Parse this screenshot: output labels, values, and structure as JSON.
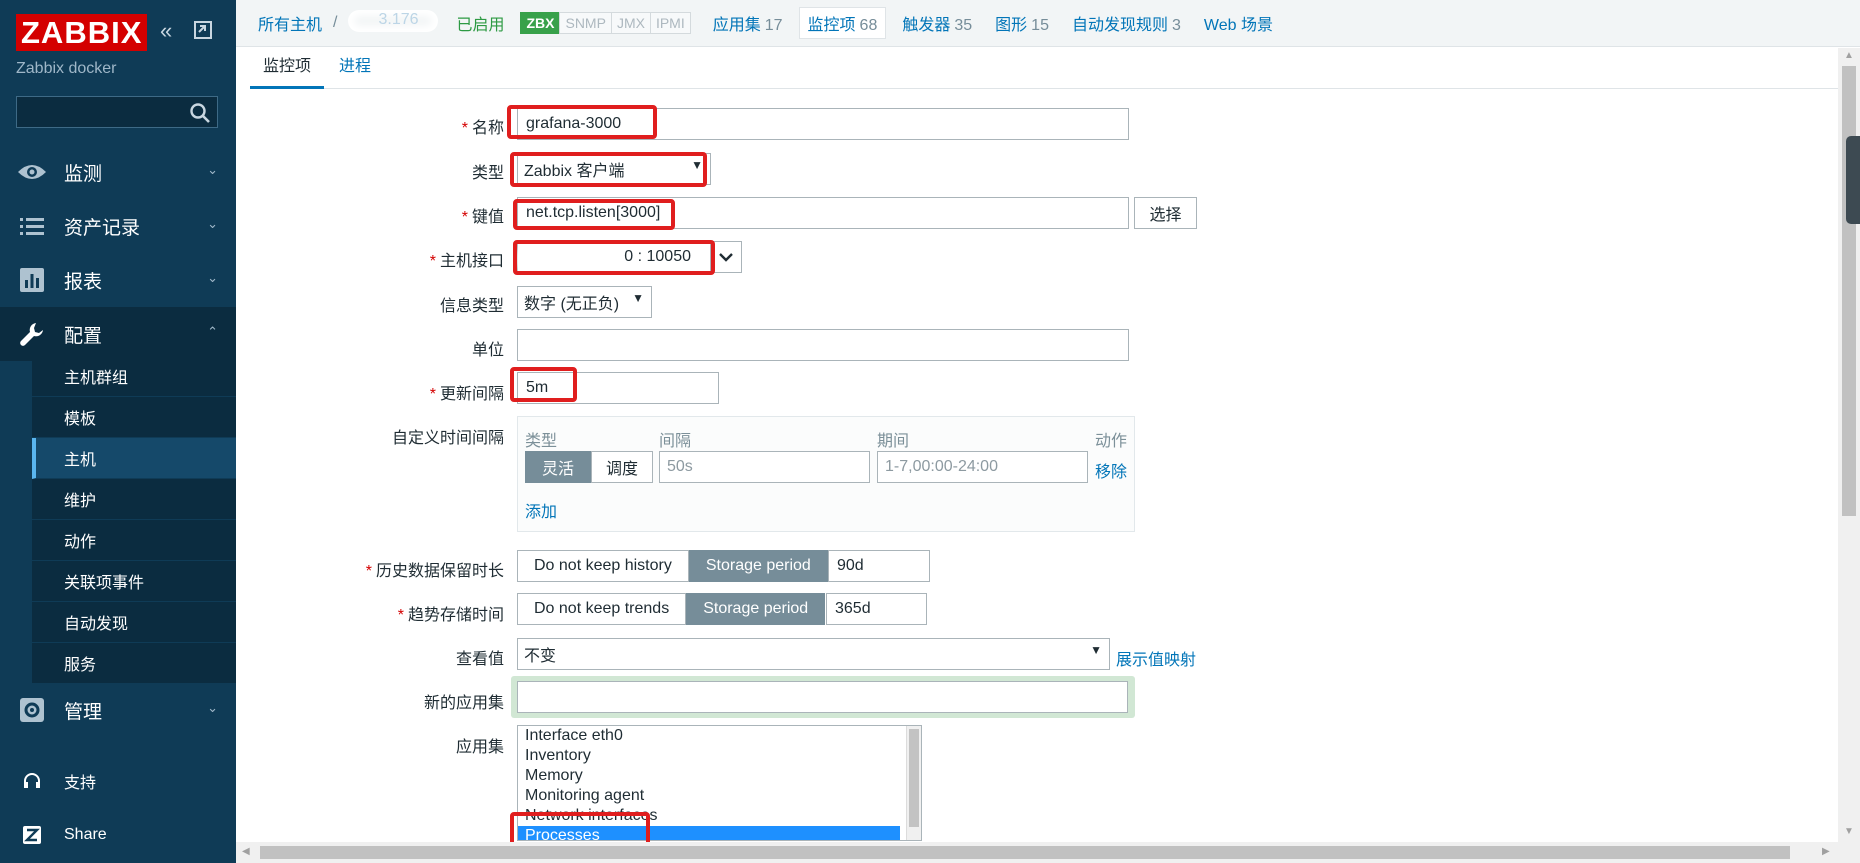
{
  "sidebar": {
    "logo": "ZABBIX",
    "server_name": "Zabbix docker",
    "search_placeholder": "",
    "sections": [
      {
        "label": "监测",
        "icon": "eye-icon"
      },
      {
        "label": "资产记录",
        "icon": "list-icon"
      },
      {
        "label": "报表",
        "icon": "bar-chart-icon"
      },
      {
        "label": "配置",
        "icon": "wrench-icon"
      },
      {
        "label": "管理",
        "icon": "gear-icon"
      }
    ],
    "config_items": [
      "主机群组",
      "模板",
      "主机",
      "维护",
      "动作",
      "关联项事件",
      "自动发现",
      "服务"
    ],
    "active_config_item": "主机",
    "footer": [
      {
        "label": "支持",
        "icon": "headset-icon"
      },
      {
        "label": "Share",
        "icon": "zabbix-share-icon"
      }
    ]
  },
  "topnav": {
    "all_hosts": "所有主机",
    "separator": "/",
    "host_name_visible": "3.176",
    "status": "已启用",
    "tags": [
      "ZBX",
      "SNMP",
      "JMX",
      "IPMI"
    ],
    "items": [
      {
        "label": "应用集",
        "count": "17"
      },
      {
        "label": "监控项",
        "count": "68"
      },
      {
        "label": "触发器",
        "count": "35"
      },
      {
        "label": "图形",
        "count": "15"
      },
      {
        "label": "自动发现规则",
        "count": "3"
      },
      {
        "label": "Web 场景",
        "count": ""
      }
    ]
  },
  "tabs": [
    "监控项",
    "进程"
  ],
  "form": {
    "name_label": "名称",
    "name_value": "grafana-3000",
    "type_label": "类型",
    "type_value": "Zabbix 客户端",
    "key_label": "键值",
    "key_value": "net.tcp.listen[3000]",
    "select_button": "选择",
    "interface_label": "主机接口",
    "interface_value": "0 : 10050",
    "info_type_label": "信息类型",
    "info_type_value": "数字 (无正负)",
    "units_label": "单位",
    "units_value": "",
    "interval_label": "更新间隔",
    "interval_value": "5m",
    "custom_label": "自定义时间间隔",
    "custom": {
      "headers": [
        "类型",
        "间隔",
        "期间",
        "动作"
      ],
      "type_options": [
        "灵活",
        "调度"
      ],
      "interval_placeholder": "50s",
      "period_placeholder": "1-7,00:00-24:00",
      "remove": "移除",
      "add": "添加"
    },
    "history_label": "历史数据保留时长",
    "history_options": [
      "Do not keep history",
      "Storage period"
    ],
    "history_value": "90d",
    "trends_label": "趋势存储时间",
    "trends_options": [
      "Do not keep trends",
      "Storage period"
    ],
    "trends_value": "365d",
    "valuemap_label": "查看值",
    "valuemap_value": "不变",
    "valuemap_link": "展示值映射",
    "new_app_label": "新的应用集",
    "new_app_value": "",
    "apps_label": "应用集",
    "apps": [
      "Interface eth0",
      "Inventory",
      "Memory",
      "Monitoring agent",
      "Network interfaces",
      "Processes"
    ],
    "selected_app": "Processes"
  },
  "colors": {
    "sidebar_bg": "#0f3b56",
    "accent": "#0275b8",
    "logo_red": "#d40000",
    "enabled_green": "#2d9a43",
    "highlight_red": "#e01e1e",
    "selected_blue": "#1e90ff"
  }
}
